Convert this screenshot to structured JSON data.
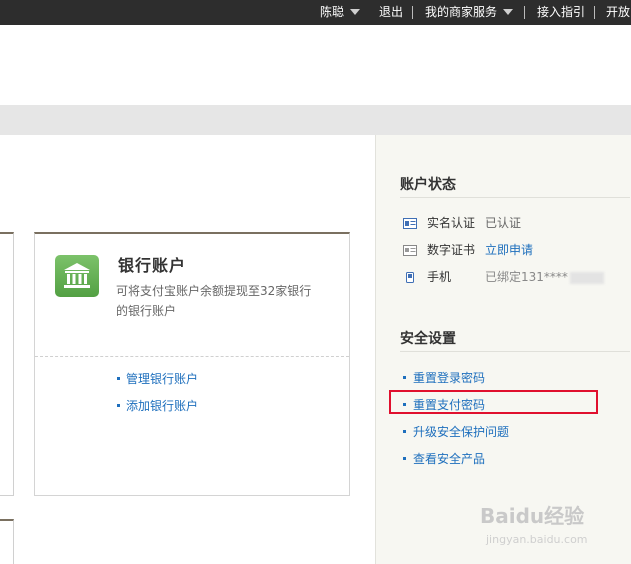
{
  "topnav": {
    "user": "陈聪",
    "logout": "退出",
    "merchant_services": "我的商家服务",
    "integration_guide": "接入指引",
    "open_platform": "开放"
  },
  "bank_card": {
    "title": "银行账户",
    "description": "可将支付宝账户余额提现至32家银行的银行账户",
    "links": [
      {
        "label": "管理银行账户"
      },
      {
        "label": "添加银行账户"
      }
    ]
  },
  "account_status": {
    "title": "账户状态",
    "rows": [
      {
        "icon": "id-card-icon",
        "label": "实名认证",
        "value": "已认证"
      },
      {
        "icon": "certificate-icon",
        "label": "数字证书",
        "value": "立即申请"
      },
      {
        "icon": "phone-icon",
        "label": "手机",
        "value": "已绑定131****"
      }
    ]
  },
  "security": {
    "title": "安全设置",
    "links": [
      {
        "label": "重置登录密码"
      },
      {
        "label": "重置支付密码"
      },
      {
        "label": "升级安全保护问题"
      },
      {
        "label": "查看安全产品"
      }
    ]
  },
  "colors": {
    "topbar": "#2d2d2d",
    "link": "#1e6fbd",
    "highlight": "#e0102e",
    "bank_icon": "#5aa84a"
  },
  "watermark": {
    "text": "Baidu经验",
    "sub": "jingyan.baidu.com"
  }
}
